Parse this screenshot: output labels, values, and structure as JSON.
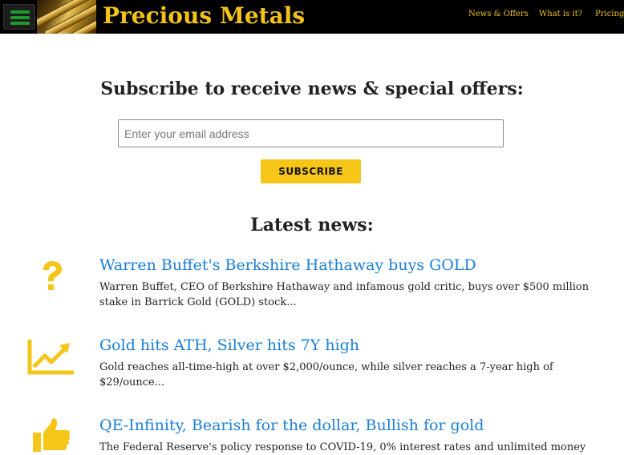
{
  "header": {
    "brand": "Precious Metals",
    "nav": [
      {
        "label": "News & Offers"
      },
      {
        "label": "What is it?"
      },
      {
        "label": "Pricing"
      }
    ],
    "accent_color": "#f2c21b",
    "menu_icon": "hamburger-icon",
    "logo_icon": "gold-bars-logo"
  },
  "subscribe": {
    "title": "Subscribe to receive news & special offers:",
    "email_placeholder": "Enter your email address",
    "email_value": "",
    "button_label": "SUBSCRIBE",
    "button_color": "#f5c518"
  },
  "news": {
    "title": "Latest news:",
    "link_color": "#1a7fd4",
    "items": [
      {
        "icon": "question-mark-icon",
        "headline": "Warren Buffet's Berkshire Hathaway buys GOLD",
        "summary": "Warren Buffet, CEO of Berkshire Hathaway and infamous gold critic, buys over $500 million stake in Barrick Gold (GOLD) stock..."
      },
      {
        "icon": "trending-up-chart-icon",
        "headline": "Gold hits ATH, Silver hits 7Y high",
        "summary": "Gold reaches all-time-high at over $2,000/ounce, while silver reaches a 7-year high of $29/ounce..."
      },
      {
        "icon": "thumbs-up-icon",
        "headline": "QE-Infinity, Bearish for the dollar, Bullish for gold",
        "summary": "The Federal Reserve's policy response to COVID-19, 0% interest rates and unlimited money printing,"
      }
    ]
  }
}
